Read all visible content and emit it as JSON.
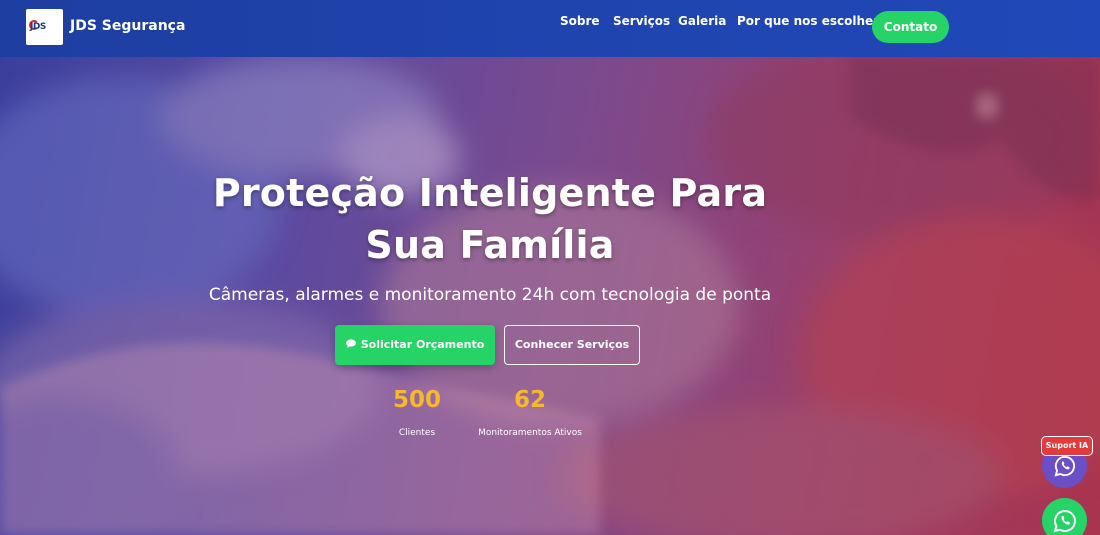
{
  "header": {
    "logo_text": "JDS",
    "brand": "JDS Segurança",
    "nav": {
      "sobre": "Sobre",
      "servicos": "Serviços",
      "galeria": "Galeria",
      "porque": "Por que nos escolher"
    },
    "contato": "Contato"
  },
  "hero": {
    "title": "Proteção Inteligente Para Sua Família",
    "subtitle": "Câmeras, alarmes e monitoramento 24h com tecnologia de ponta",
    "cta_primary": "Solicitar Orçamento",
    "cta_primary_icon": "speech-bubble",
    "cta_secondary": "Conhecer Serviços"
  },
  "stats": [
    {
      "value": "500",
      "label": "Clientes"
    },
    {
      "value": "62",
      "label": "Monitoramentos Ativos"
    }
  ],
  "floating": {
    "ia_badge": "Suport IA",
    "ia_icon": "whatsapp-icon",
    "whatsapp_icon": "whatsapp-icon"
  },
  "colors": {
    "nav_bg": "#1f45b0",
    "accent_green": "#25d366",
    "stat_yellow": "#f5b82e",
    "badge_red": "#e23b3b"
  }
}
